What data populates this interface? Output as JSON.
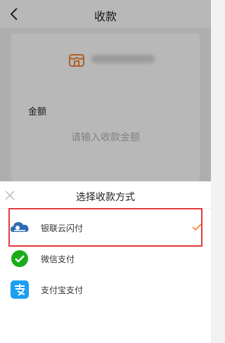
{
  "header": {
    "title": "收款"
  },
  "card": {
    "amount_label": "金额",
    "amount_input": {
      "placeholder": "请输入收款金额",
      "value": ""
    }
  },
  "payment_sheet": {
    "title": "选择收款方式",
    "options": [
      {
        "label": "银联云闪付",
        "icon": "unionpay-cloud-icon",
        "selected": true
      },
      {
        "label": "微信支付",
        "icon": "wechat-pay-icon",
        "selected": false
      },
      {
        "label": "支付宝支付",
        "icon": "alipay-icon",
        "selected": false
      }
    ]
  },
  "colors": {
    "accent": "#f0883a",
    "highlight_border": "#e23a3a",
    "wechat_green": "#1aad19",
    "alipay_blue": "#1a9ff1",
    "unionpay_blue": "#2f6db3"
  }
}
